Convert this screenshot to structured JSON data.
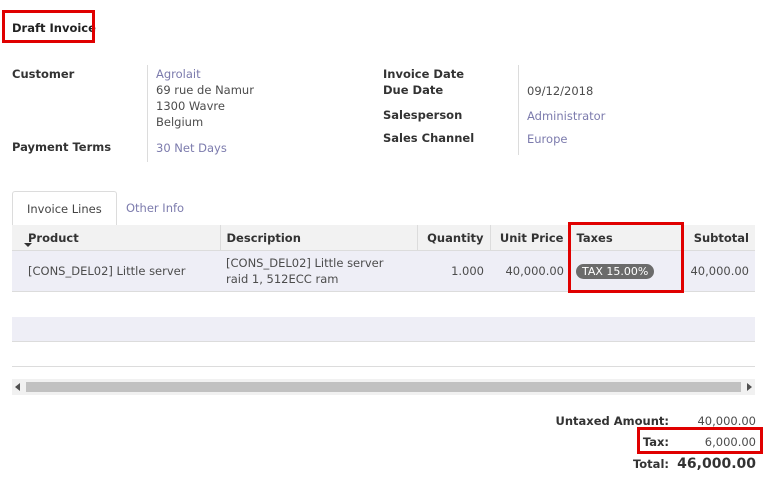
{
  "title": "Draft Invoice",
  "customer": {
    "label": "Customer",
    "name": "Agrolait",
    "address1": "69 rue de Namur",
    "address2": "1300 Wavre",
    "address3": "Belgium"
  },
  "payment_terms": {
    "label": "Payment Terms",
    "value": "30 Net Days"
  },
  "invoice_date": {
    "label": "Invoice Date",
    "value": ""
  },
  "due_date": {
    "label": "Due Date",
    "value": "09/12/2018"
  },
  "salesperson": {
    "label": "Salesperson",
    "value": "Administrator"
  },
  "sales_channel": {
    "label": "Sales Channel",
    "value": "Europe"
  },
  "tabs": [
    {
      "label": "Invoice Lines",
      "active": true
    },
    {
      "label": "Other Info",
      "active": false
    }
  ],
  "table": {
    "columns": [
      "Product",
      "Description",
      "Quantity",
      "Unit Price",
      "Taxes",
      "Subtotal"
    ],
    "rows": [
      {
        "product": "[CONS_DEL02] Little server",
        "description_line1": "[CONS_DEL02] Little server",
        "description_line2": "raid 1, 512ECC ram",
        "quantity": "1.000",
        "unit_price": "40,000.00",
        "taxes": "TAX 15.00%",
        "subtotal": "40,000.00"
      }
    ]
  },
  "totals": {
    "untaxed_label": "Untaxed Amount:",
    "untaxed_value": "40,000.00",
    "tax_label": "Tax:",
    "tax_value": "6,000.00",
    "total_label": "Total:",
    "total_value": "46,000.00"
  },
  "colors": {
    "highlight": "#e00000",
    "link": "#7c7bad",
    "row_bg": "#eeeef6",
    "badge": "#6b6b6b"
  }
}
